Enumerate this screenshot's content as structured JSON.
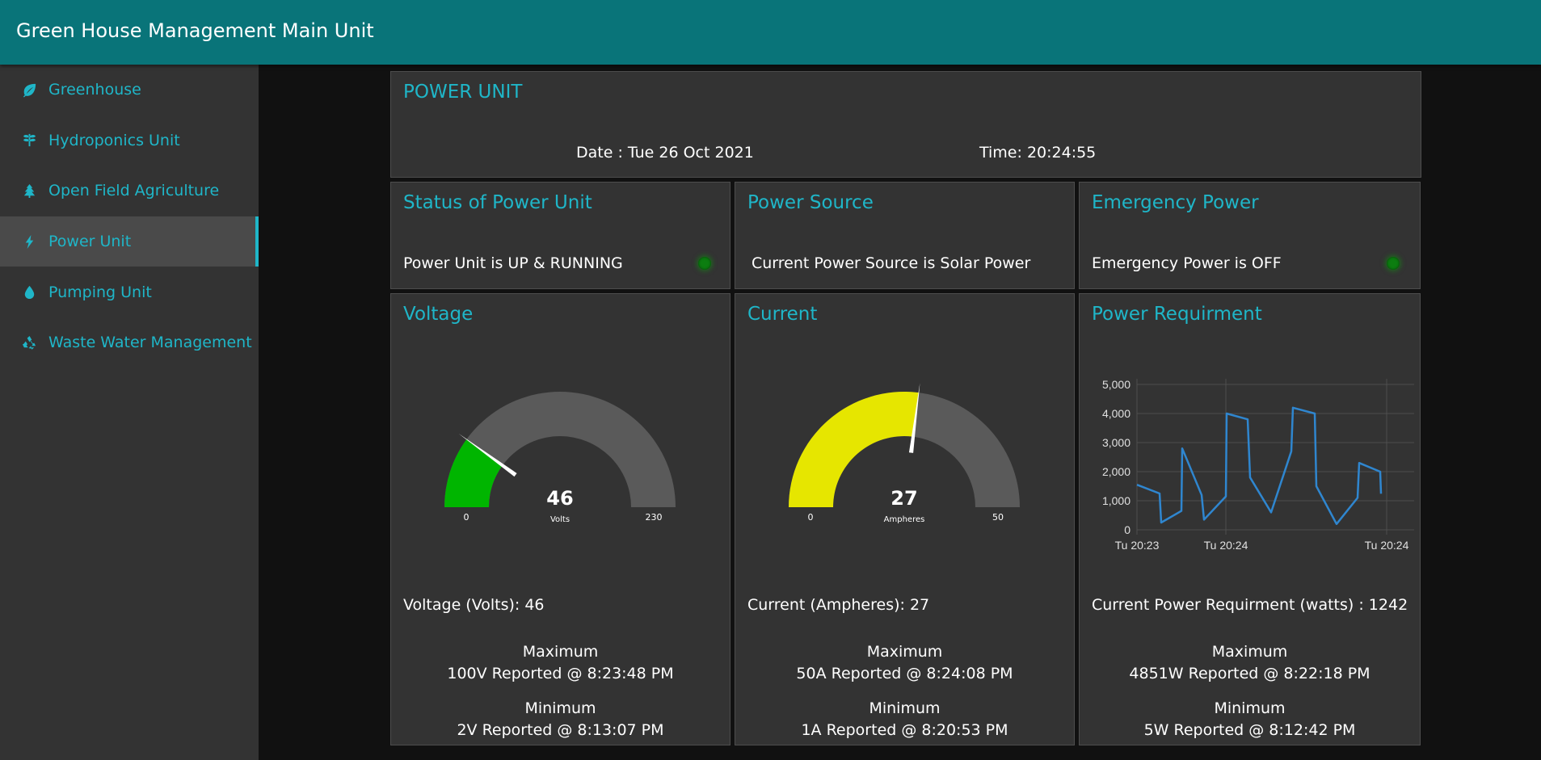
{
  "app": {
    "title": "Green House Management Main Unit"
  },
  "sidebar": {
    "items": [
      {
        "label": "Greenhouse",
        "icon": "leaf-icon",
        "active": false
      },
      {
        "label": "Hydroponics Unit",
        "icon": "seedling-icon",
        "active": false
      },
      {
        "label": "Open Field Agriculture",
        "icon": "tree-icon",
        "active": false
      },
      {
        "label": "Power Unit",
        "icon": "bolt-icon",
        "active": true
      },
      {
        "label": "Pumping Unit",
        "icon": "water-drop-icon",
        "active": false
      },
      {
        "label": "Waste Water Management",
        "icon": "recycle-icon",
        "active": false
      }
    ]
  },
  "header_card": {
    "title": "POWER UNIT",
    "date": "Date : Tue 26 Oct 2021",
    "time": "Time: 20:24:55"
  },
  "status": {
    "title": "Status of Power Unit",
    "text": "Power Unit is UP & RUNNING",
    "led_color": "#0c7d10"
  },
  "source": {
    "title": "Power Source",
    "text": "Current Power Source is Solar Power"
  },
  "emergency": {
    "title": "Emergency Power",
    "text": "Emergency Power is OFF",
    "led_color": "#0c7d10"
  },
  "voltage": {
    "title": "Voltage",
    "gauge": {
      "value": 46,
      "value_label": "46",
      "unit": "Volts",
      "min": 0,
      "max": 230,
      "min_label": "0",
      "max_label": "230",
      "color": "#00b500"
    },
    "reading": "Voltage (Volts): 46",
    "max_label": "Maximum",
    "max_value": "100V Reported @ 8:23:48 PM",
    "min_label": "Minimum",
    "min_value": "2V Reported @ 8:13:07 PM"
  },
  "current": {
    "title": "Current",
    "gauge": {
      "value": 27,
      "value_label": "27",
      "unit": "Ampheres",
      "min": 0,
      "max": 50,
      "min_label": "0",
      "max_label": "50",
      "color": "#e6e600"
    },
    "reading": "Current (Ampheres): 27",
    "max_label": "Maximum",
    "max_value": "50A Reported @ 8:24:08 PM",
    "min_label": "Minimum",
    "min_value": "1A Reported @ 8:20:53 PM"
  },
  "power": {
    "title": "Power Requirment",
    "reading": "Current Power Requirment (watts) : 1242",
    "max_label": "Maximum",
    "max_value": "4851W Reported @ 8:22:18 PM",
    "min_label": "Minimum",
    "min_value": "5W Reported @ 8:12:42 PM"
  },
  "chart_data": {
    "type": "line",
    "color": "#2f86cf",
    "ylim": [
      0,
      5000
    ],
    "yticks": [
      0,
      1000,
      2000,
      3000,
      4000,
      5000
    ],
    "ytick_labels": [
      "0",
      "1,000",
      "2,000",
      "3,000",
      "4,000",
      "5,000"
    ],
    "xtick_labels": [
      "Tu 20:23",
      "Tu 20:24",
      "Tu 20:24"
    ],
    "grid": true,
    "values": [
      1550,
      1250,
      250,
      650,
      2800,
      1200,
      350,
      1150,
      4000,
      3800,
      1800,
      600,
      2700,
      4200,
      4000,
      1500,
      200,
      1100,
      2300,
      2000,
      1242
    ]
  },
  "colors": {
    "accent": "#1fb6c8",
    "topbar": "#097479",
    "card": "#333333",
    "background": "#111111",
    "gauge_track": "#5a5a5a"
  }
}
